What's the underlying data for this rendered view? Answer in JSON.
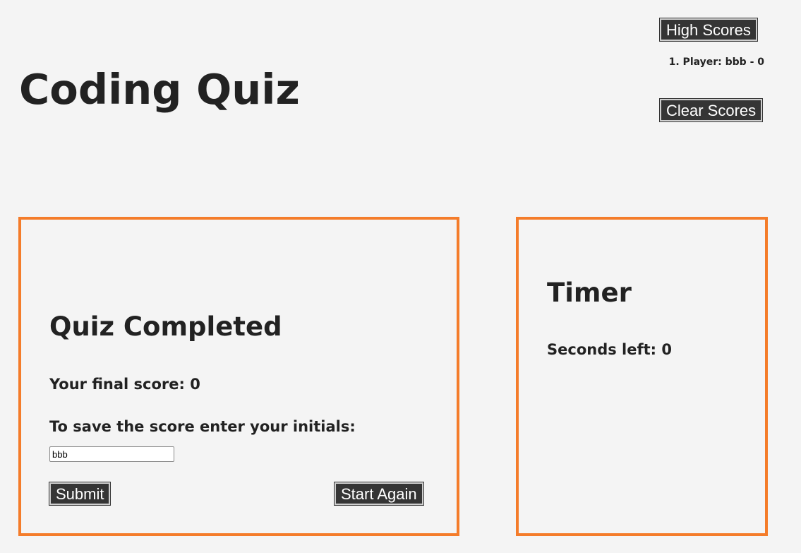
{
  "header": {
    "title": "Coding Quiz",
    "high_scores_label": "High Scores",
    "clear_scores_label": "Clear Scores",
    "scores": [
      "1. Player: bbb - 0"
    ]
  },
  "quiz": {
    "heading": "Quiz Completed",
    "final_score_text": "Your final score: 0",
    "initials_label": "To save the score enter your initials:",
    "initials_value": "bbb",
    "submit_label": "Submit",
    "start_again_label": "Start Again"
  },
  "timer": {
    "heading": "Timer",
    "seconds_text": "Seconds left: 0"
  },
  "colors": {
    "accent_border": "#f47c2a",
    "button_bg": "#353535",
    "page_bg": "#f4f4f4"
  }
}
